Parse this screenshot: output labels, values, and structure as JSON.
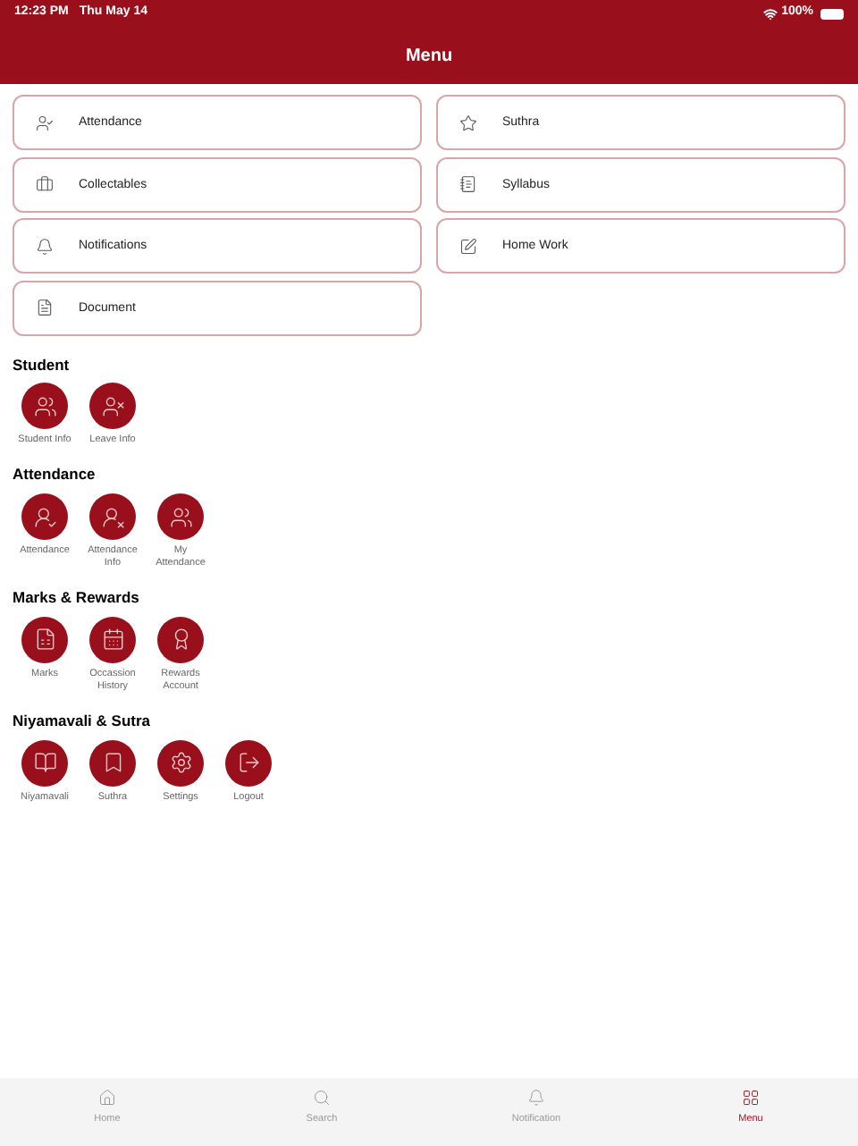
{
  "status_bar": {
    "time": "12:23 PM",
    "date": "Thu May 14",
    "battery": "100%"
  },
  "header": {
    "title": "Menu"
  },
  "menu_columns": [
    {
      "items": [
        {
          "label": "Attendance"
        },
        {
          "label": "Collectables"
        },
        {
          "label": "Notifications"
        },
        {
          "label": "Document"
        }
      ]
    },
    {
      "items": [
        {
          "label": "Suthra"
        },
        {
          "label": "Syllabus"
        },
        {
          "label": "Home Work"
        }
      ]
    }
  ],
  "sections": [
    {
      "title": "Student",
      "items": [
        {
          "label": "Student Info"
        },
        {
          "label": "Leave Info"
        }
      ]
    },
    {
      "title": "Attendance",
      "items": [
        {
          "label": "Attendance"
        },
        {
          "label": "Attendance Info"
        },
        {
          "label": "My Attendance"
        }
      ]
    },
    {
      "title": "Marks & Rewards",
      "items": [
        {
          "label": "Marks"
        },
        {
          "label": "Occassion History"
        },
        {
          "label": "Rewards Account"
        }
      ]
    },
    {
      "title": "Niyamavali & Sutra",
      "items": [
        {
          "label": "Niyamavali"
        },
        {
          "label": "Suthra"
        },
        {
          "label": "Settings"
        },
        {
          "label": "Logout"
        }
      ]
    }
  ],
  "tab_bar": [
    {
      "label": "Home",
      "selected": false
    },
    {
      "label": "Search",
      "selected": false
    },
    {
      "label": "Notification",
      "selected": false
    },
    {
      "label": "Menu",
      "selected": true
    }
  ]
}
